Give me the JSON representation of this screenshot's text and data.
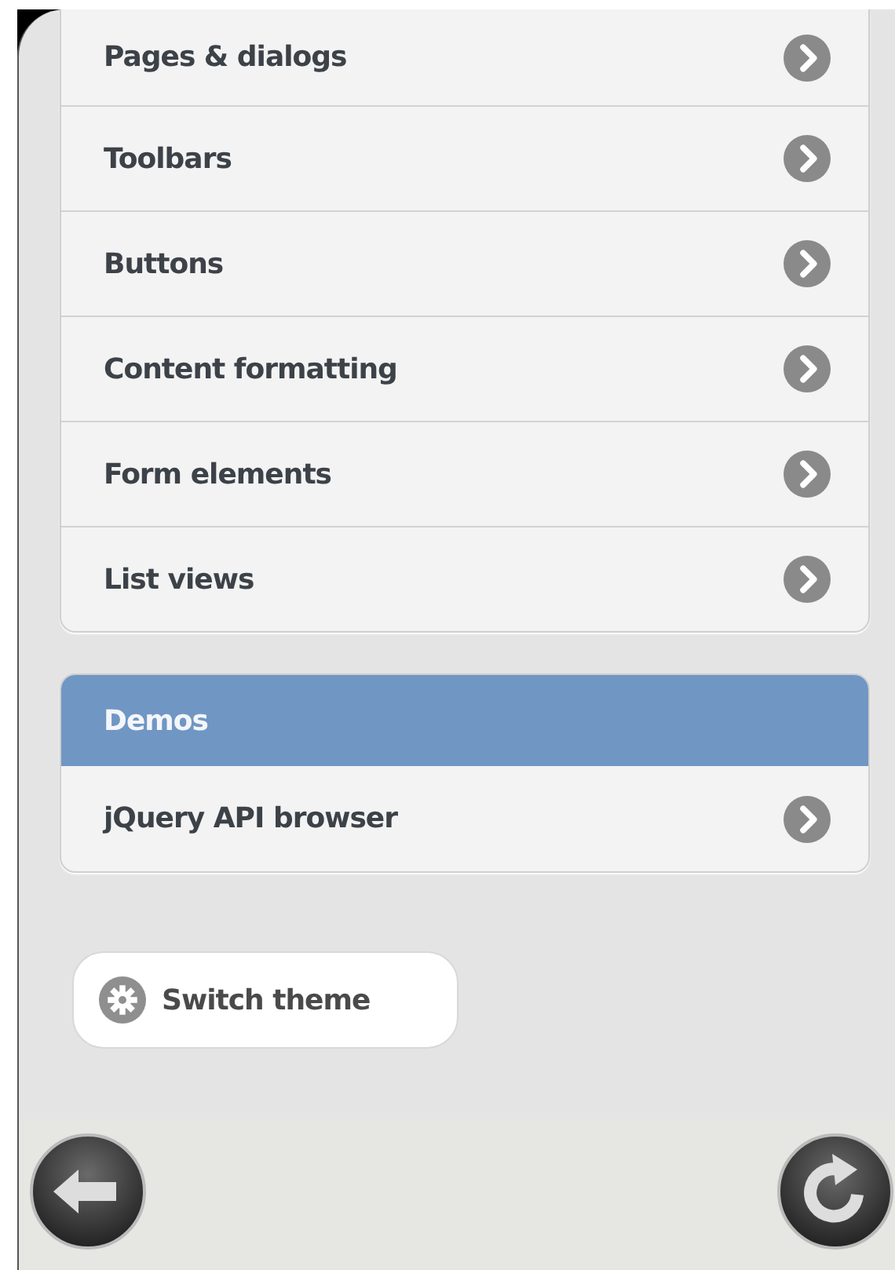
{
  "groups": [
    {
      "items": [
        {
          "label": "Pages & dialogs"
        },
        {
          "label": "Toolbars"
        },
        {
          "label": "Buttons"
        },
        {
          "label": "Content formatting"
        },
        {
          "label": "Form elements"
        },
        {
          "label": "List views"
        }
      ]
    },
    {
      "header": "Demos",
      "items": [
        {
          "label": "jQuery API browser"
        }
      ]
    }
  ],
  "theme_button": {
    "label": "Switch theme"
  },
  "footer_buttons": [
    {
      "kind": "back"
    },
    {
      "kind": "reload"
    }
  ]
}
